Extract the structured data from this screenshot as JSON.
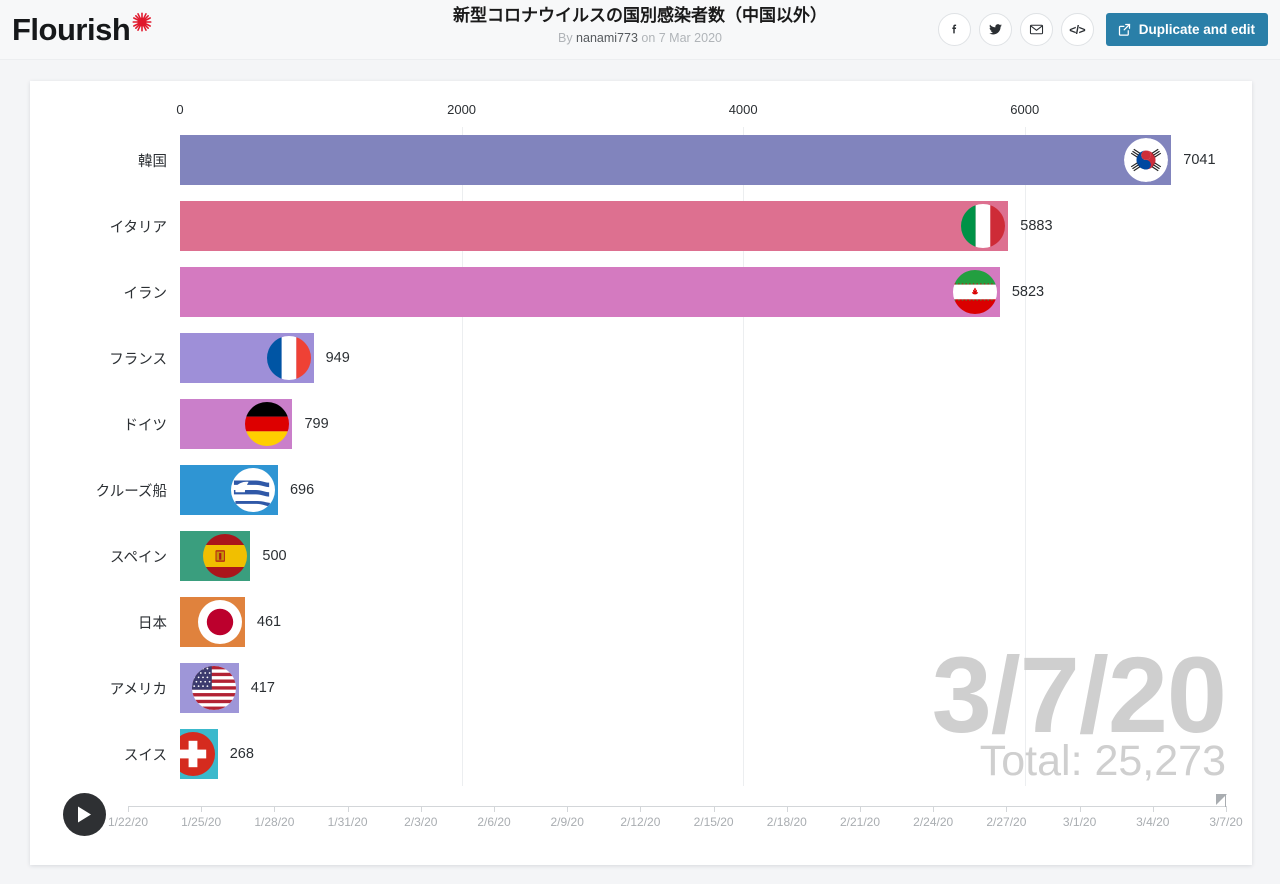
{
  "header": {
    "logo_text": "Flourish",
    "logo_icon": "coronavirus-starburst-icon",
    "title": "新型コロナウイルスの国別感染者数（中国以外）",
    "byline_prefix": "By ",
    "byline_author": "nanami773",
    "byline_suffix": " on 7 Mar 2020",
    "share_buttons": [
      {
        "name": "facebook-icon",
        "label": "f"
      },
      {
        "name": "twitter-icon",
        "label": ""
      },
      {
        "name": "email-icon",
        "label": ""
      },
      {
        "name": "embed-code-icon",
        "label": "</>"
      }
    ],
    "duplicate_button": "Duplicate and edit",
    "accent_color": "#2a7fa8"
  },
  "chart_data": {
    "type": "bar",
    "title": "新型コロナウイルスの国別感染者数（中国以外）",
    "orientation": "horizontal",
    "xlabel": "",
    "ylabel": "",
    "xlim": [
      0,
      7600
    ],
    "xticks": [
      "0",
      "2000",
      "4000",
      "6000"
    ],
    "xtick_values": [
      0,
      2000,
      4000,
      6000
    ],
    "grid": true,
    "legend": "none",
    "categories": [
      "韓国",
      "イタリア",
      "イラン",
      "フランス",
      "ドイツ",
      "クルーズ船",
      "スペイン",
      "日本",
      "アメリカ",
      "スイス"
    ],
    "values": [
      7041,
      5883,
      5823,
      949,
      799,
      696,
      500,
      461,
      417,
      268
    ],
    "value_labels": [
      "7041",
      "5883",
      "5823",
      "949",
      "799",
      "696",
      "500",
      "461",
      "417",
      "268"
    ],
    "bar_colors": [
      "#8184bd",
      "#dd7090",
      "#d47ac0",
      "#9e8fd8",
      "#ca7fca",
      "#2f95d3",
      "#3a9e7e",
      "#e0823d",
      "#9e96d8",
      "#3bb9cc"
    ],
    "flags": [
      "south-korea-flag",
      "italy-flag",
      "iran-flag",
      "france-flag",
      "germany-flag",
      "cruise-ship-flag",
      "spain-flag",
      "japan-flag",
      "usa-flag",
      "switzerland-flag"
    ],
    "annotation_date": "3/7/20",
    "annotation_total": "Total: 25,273",
    "annotation_color": "#cfcfcf"
  },
  "timeline": {
    "play_icon": "play-icon",
    "ticks": [
      "1/22/20",
      "1/25/20",
      "1/28/20",
      "1/31/20",
      "2/3/20",
      "2/6/20",
      "2/9/20",
      "2/12/20",
      "2/15/20",
      "2/18/20",
      "2/21/20",
      "2/24/20",
      "2/27/20",
      "3/1/20",
      "3/4/20",
      "3/7/20"
    ],
    "current_position": "3/7/20"
  }
}
